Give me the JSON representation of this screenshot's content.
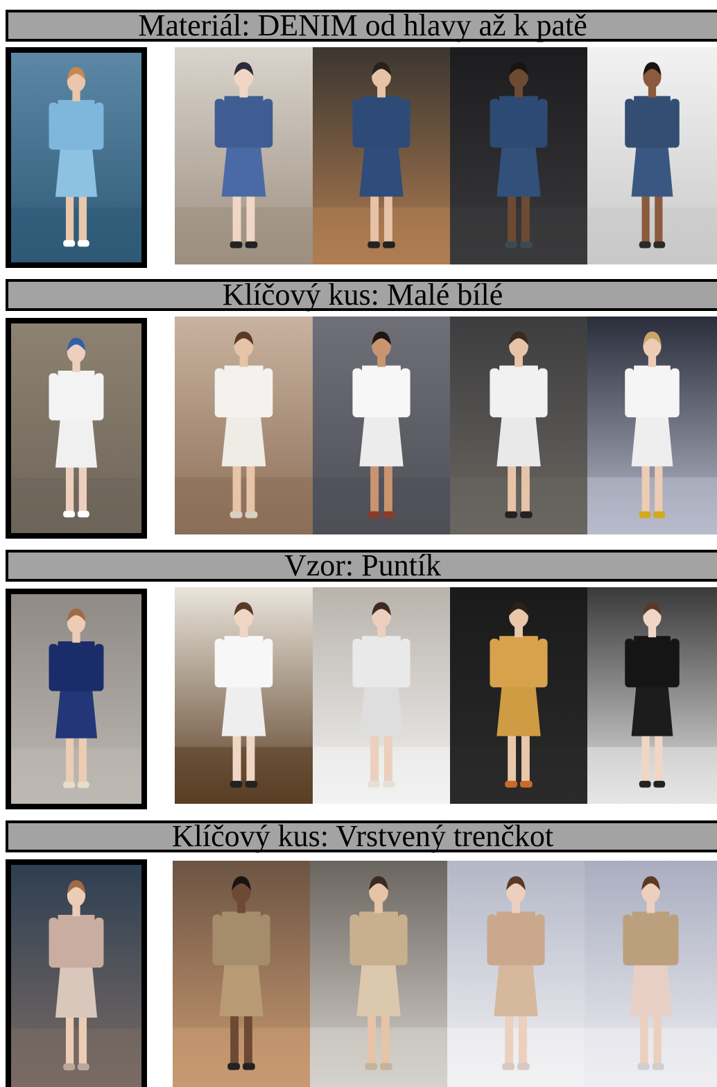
{
  "sections": [
    {
      "title": "Materiál: DENIM od hlavy až k patě",
      "photo": {
        "bg": [
          "#5c88a6",
          "#2e5a76"
        ],
        "garment": "#7fb6dc",
        "garment2": "#8ec2e2",
        "skin": "#e9c6ac",
        "hair": "#c9874f",
        "shoe": "#ffffff"
      },
      "looks": [
        {
          "bg": [
            "#d9d4cc",
            "#9d8f80"
          ],
          "garment": "#3f5d93",
          "garment2": "#4a6aa6",
          "skin": "#f0d6c4",
          "hair": "#2b2b3b",
          "shoe": "#222222"
        },
        {
          "bg": [
            "#3b3630",
            "#b07d52"
          ],
          "garment": "#2e4b77",
          "garment2": "#2f4c7a",
          "skin": "#e6c3a8",
          "hair": "#2a2118",
          "shoe": "#222222"
        },
        {
          "bg": [
            "#1c1c1e",
            "#3a3a3c"
          ],
          "garment": "#2c4a73",
          "garment2": "#32507a",
          "skin": "#6d4a34",
          "hair": "#1a1411",
          "shoe": "#3c4a52"
        },
        {
          "bg": [
            "#f2f2f2",
            "#c9c9c9"
          ],
          "garment": "#334e72",
          "garment2": "#3a5781",
          "skin": "#8c5a3c",
          "hair": "#1a1411",
          "shoe": "#2a2a2a"
        }
      ]
    },
    {
      "title": "Klíčový kus: Malé bílé",
      "photo": {
        "bg": [
          "#8d8271",
          "#6e655a"
        ],
        "garment": "#f3f3f3",
        "garment2": "#f0f0f0",
        "skin": "#eccfbd",
        "hair": "#2f5fa8",
        "shoe": "#ffffff"
      },
      "looks": [
        {
          "bg": [
            "#c8b3a0",
            "#8c6e57"
          ],
          "garment": "#f4f2ee",
          "garment2": "#efece6",
          "skin": "#e7c4a7",
          "hair": "#5a3a26",
          "shoe": "#d9d0c4"
        },
        {
          "bg": [
            "#6f6f78",
            "#4f4f58"
          ],
          "garment": "#f7f7f7",
          "garment2": "#ececec",
          "skin": "#c8956f",
          "hair": "#1f1612",
          "shoe": "#8a3b2a"
        },
        {
          "bg": [
            "#3d3d3f",
            "#6a6660"
          ],
          "garment": "#f1f1f1",
          "garment2": "#e9e9e9",
          "skin": "#e7c4a7",
          "hair": "#3a2a20",
          "shoe": "#222222"
        },
        {
          "bg": [
            "#2a2d3a",
            "#b8bccc"
          ],
          "garment": "#f5f5f5",
          "garment2": "#eeeeee",
          "skin": "#ecccb4",
          "hair": "#c9a56a",
          "shoe": "#d4a81e"
        }
      ]
    },
    {
      "title": "Vzor: Puntík",
      "photo": {
        "bg": [
          "#8f8a86",
          "#bdb8b2"
        ],
        "garment": "#1b2c6a",
        "garment2": "#223678",
        "skin": "#ecccb4",
        "hair": "#a06a45",
        "shoe": "#e8dccb"
      },
      "looks": [
        {
          "bg": [
            "#e9e4db",
            "#5a3e24"
          ],
          "garment": "#f7f7f7",
          "garment2": "#eeeeee",
          "skin": "#f0d6c4",
          "hair": "#5a3a26",
          "shoe": "#222222"
        },
        {
          "bg": [
            "#b9b3ac",
            "#f2f2f2"
          ],
          "garment": "#e9e9e9",
          "garment2": "#dedede",
          "skin": "#eccfbd",
          "hair": "#3a2a20",
          "shoe": "#e6e0d8"
        },
        {
          "bg": [
            "#1a1a1a",
            "#2a2a2a"
          ],
          "garment": "#d7a24b",
          "garment2": "#cf9b43",
          "skin": "#e8c7aa",
          "hair": "#2a2118",
          "shoe": "#c96a2a"
        },
        {
          "bg": [
            "#3a3a3a",
            "#e6e6e6"
          ],
          "garment": "#151515",
          "garment2": "#1c1c1c",
          "skin": "#f0d6c4",
          "hair": "#5a3a26",
          "shoe": "#222222"
        }
      ]
    },
    {
      "title": "Klíčový kus: Vrstvený trenčkot",
      "photo": {
        "bg": [
          "#2e3f52",
          "#7a6b64"
        ],
        "garment": "#c8ada0",
        "garment2": "#d9c7bb",
        "skin": "#ecccb4",
        "hair": "#a06a45",
        "shoe": "#bca59a"
      },
      "looks": [
        {
          "bg": [
            "#6d5443",
            "#c99a72"
          ],
          "garment": "#a58c6a",
          "garment2": "#b89a74",
          "skin": "#6d4a34",
          "hair": "#1a1411",
          "shoe": "#222222"
        },
        {
          "bg": [
            "#6b6560",
            "#d6d2cc"
          ],
          "garment": "#c8b08e",
          "garment2": "#dcc8ac",
          "skin": "#e7c4a7",
          "hair": "#3a2a20",
          "shoe": "#c4b49c"
        },
        {
          "bg": [
            "#b3b7c6",
            "#f2f2f4"
          ],
          "garment": "#c9a88c",
          "garment2": "#d6b89c",
          "skin": "#eccfbd",
          "hair": "#5a3a26",
          "shoe": "#d8c8c0"
        },
        {
          "bg": [
            "#a9adbf",
            "#eeeef2"
          ],
          "garment": "#bca07e",
          "garment2": "#e8cfc6",
          "skin": "#eccfbd",
          "hair": "#5a3a26",
          "shoe": "#cfcfcf"
        }
      ]
    }
  ]
}
